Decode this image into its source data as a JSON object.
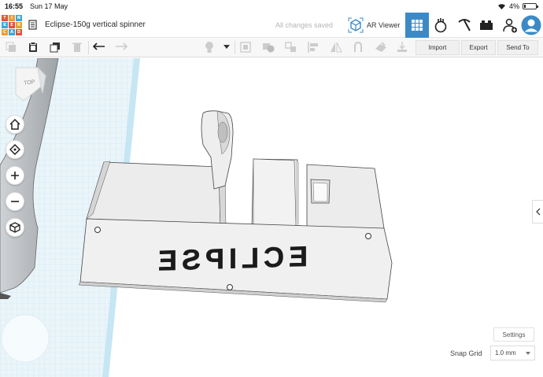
{
  "status": {
    "time": "16:55",
    "date": "Sun 17 May",
    "battery": "4%"
  },
  "header": {
    "logo_letters": [
      "T",
      "I",
      "N",
      "K",
      "E",
      "R",
      "C",
      "A",
      "D"
    ],
    "title": "Eclipse-150g vertical spinner",
    "saved": "All changes saved",
    "ar_label": "AR Viewer"
  },
  "toolbar": {
    "import_label": "Import",
    "export_label": "Export",
    "send_label": "Send To"
  },
  "viewcube": {
    "label": "TOP"
  },
  "model": {
    "text": "ECLIPSE"
  },
  "footer": {
    "settings_label": "Settings",
    "snap_label": "Snap Grid",
    "snap_value": "1.0 mm"
  },
  "colors": {
    "accent": "#3b8ac7",
    "grid": "#d6ecf5",
    "logo": [
      "#e4503e",
      "#f09c30",
      "#3ca8d8",
      "#e4503e",
      "#f09c30",
      "#3ca8d8",
      "#e4503e",
      "#f09c30",
      "#3ca8d8"
    ]
  }
}
